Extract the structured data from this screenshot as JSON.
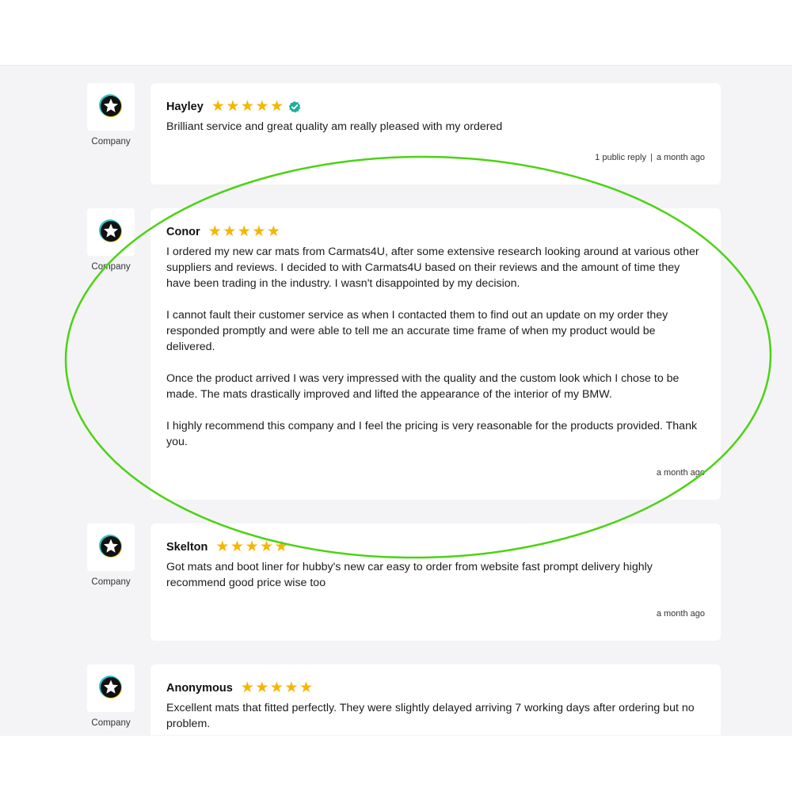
{
  "company_label": "Company",
  "reviews": [
    {
      "name": "Hayley",
      "rating": 5,
      "verified": true,
      "paragraphs": [
        "Brilliant service and great quality am really pleased with my ordered"
      ],
      "reply": "1 public reply",
      "time": "a month ago"
    },
    {
      "name": "Conor",
      "rating": 5,
      "verified": false,
      "paragraphs": [
        "I ordered my new car mats from Carmats4U, after some extensive research looking around at various other suppliers and reviews. I decided to with Carmats4U based on their reviews and the amount of time they have been trading in the industry. I wasn't disappointed by my decision.",
        "I cannot fault their customer service as when I contacted them to find out an update on my order they responded promptly and were able to tell me an accurate time frame of when my product would be delivered.",
        "Once the product arrived I was very impressed with the quality and the custom look which I chose to be made. The mats drastically improved and lifted the appearance of the interior of my BMW.",
        "I highly recommend this company and I feel the pricing is very reasonable for the products provided. Thank you."
      ],
      "time": "a month ago"
    },
    {
      "name": "Skelton",
      "rating": 5,
      "verified": false,
      "paragraphs": [
        "Got mats and boot liner for hubby's new car easy to order from website fast prompt delivery highly recommend good price wise too"
      ],
      "time": "a month ago"
    },
    {
      "name": "Anonymous",
      "rating": 5,
      "verified": false,
      "paragraphs": [
        "Excellent mats that fitted perfectly. They were slightly delayed arriving 7 working days after ordering but no problem."
      ]
    }
  ],
  "colors": {
    "star": "#f6b500",
    "verified": "#1fae9b",
    "highlight": "#4bd313",
    "background": "#f4f4f6"
  },
  "icons": {
    "company_logo": "star-circle-icon",
    "verified": "verified-check-icon"
  }
}
